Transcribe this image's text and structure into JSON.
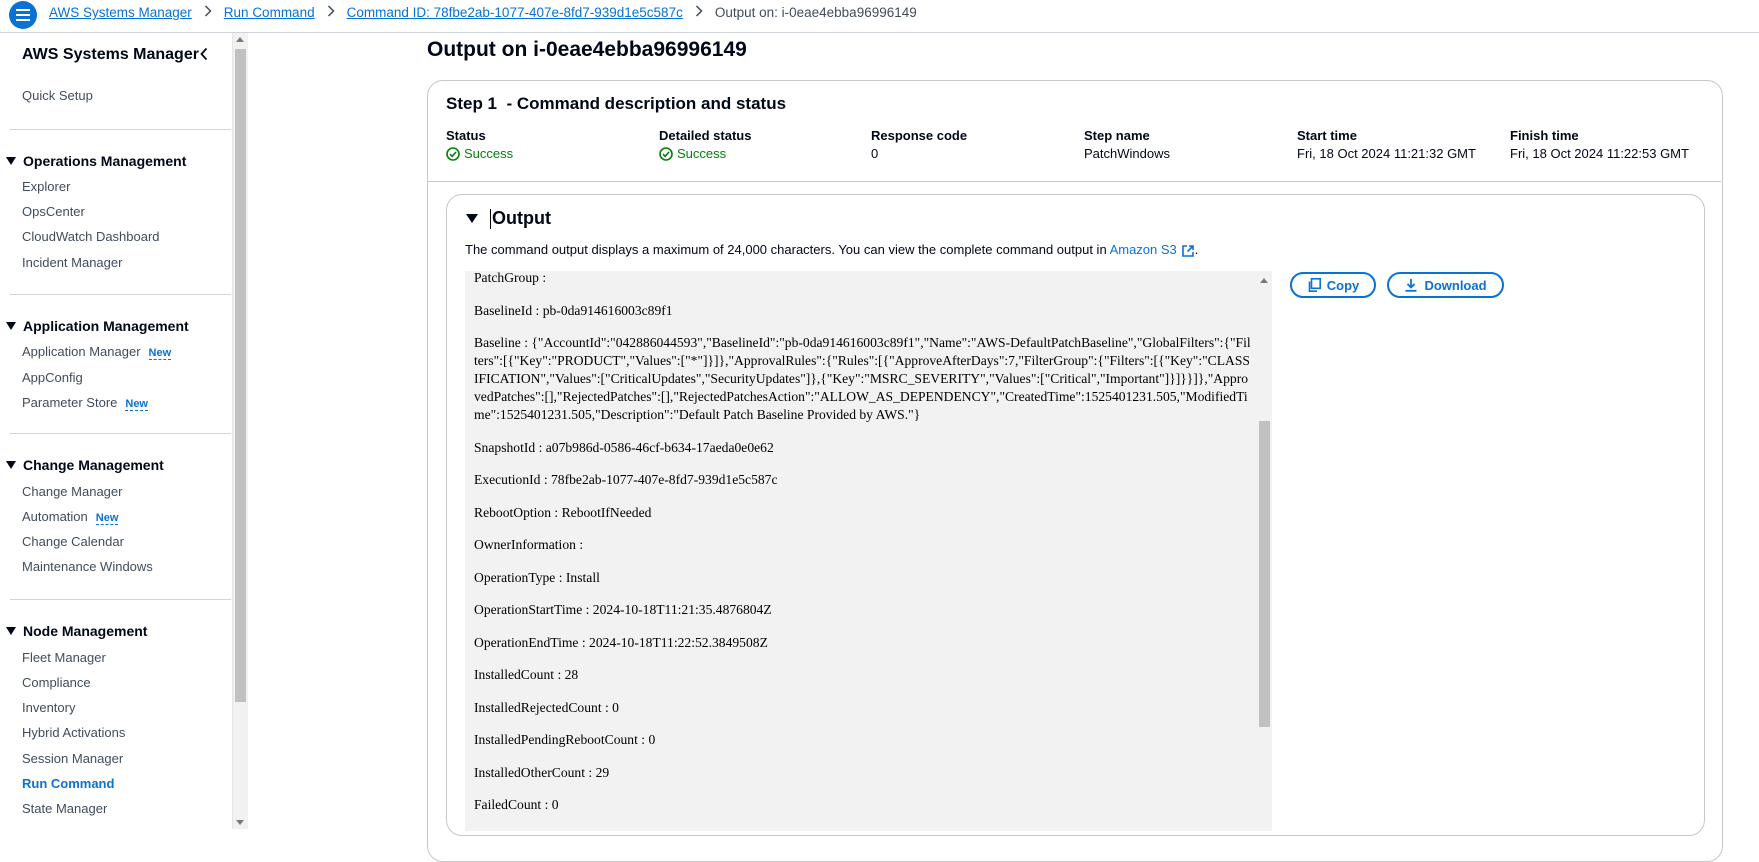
{
  "breadcrumbs": [
    "AWS Systems Manager",
    "Run Command",
    "Command ID: 78fbe2ab-1077-407e-8fd7-939d1e5c587c",
    "Output on: i-0eae4ebba96996149"
  ],
  "sidebar": {
    "title": "AWS Systems Manager",
    "quick_setup": "Quick Setup",
    "sections": [
      {
        "title": "Operations Management",
        "items": [
          "Explorer",
          "OpsCenter",
          "CloudWatch Dashboard",
          "Incident Manager"
        ]
      },
      {
        "title": "Application Management",
        "items": [
          "Application Manager",
          "AppConfig",
          "Parameter Store"
        ]
      },
      {
        "title": "Change Management",
        "items": [
          "Change Manager",
          "Automation",
          "Change Calendar",
          "Maintenance Windows"
        ]
      },
      {
        "title": "Node Management",
        "items": [
          "Fleet Manager",
          "Compliance",
          "Inventory",
          "Hybrid Activations",
          "Session Manager",
          "Run Command",
          "State Manager"
        ]
      }
    ],
    "new_badge": "New",
    "active_item": "Run Command"
  },
  "page_title": "Output on  i-0eae4ebba96996149",
  "step": {
    "title": "Step 1  - Command description and status",
    "fields": [
      {
        "label": "Status",
        "value": "Success"
      },
      {
        "label": "Detailed status",
        "value": "Success"
      },
      {
        "label": "Response code",
        "value": "0"
      },
      {
        "label": "Step name",
        "value": "PatchWindows"
      },
      {
        "label": "Start time",
        "value": "Fri, 18 Oct 2024 11:21:32 GMT"
      },
      {
        "label": "Finish time",
        "value": "Fri, 18 Oct 2024 11:22:53 GMT"
      }
    ]
  },
  "output": {
    "title": "Output",
    "description": "The command output displays a maximum of 24,000 characters. You can view the complete command output in ",
    "link": "Amazon S3",
    "description_end": ".",
    "copy_label": "Copy",
    "download_label": "Download",
    "lines": [
      "PatchGroup :",
      "BaselineId : pb-0da914616003c89f1",
      "Baseline : {\"AccountId\":\"042886044593\",\"BaselineId\":\"pb-0da914616003c89f1\",\"Name\":\"AWS-DefaultPatchBaseline\",\"GlobalFilters\":{\"Filters\":[{\"Key\":\"PRODUCT\",\"Values\":[\"*\"]}]},\"ApprovalRules\":{\"Rules\":[{\"ApproveAfterDays\":7,\"FilterGroup\":{\"Filters\":[{\"Key\":\"CLASSIFICATION\",\"Values\":[\"CriticalUpdates\",\"SecurityUpdates\"]},{\"Key\":\"MSRC_SEVERITY\",\"Values\":[\"Critical\",\"Important\"]}]}}]},\"ApprovedPatches\":[],\"RejectedPatches\":[],\"RejectedPatchesAction\":\"ALLOW_AS_DEPENDENCY\",\"CreatedTime\":1525401231.505,\"ModifiedTime\":1525401231.505,\"Description\":\"Default Patch Baseline Provided by AWS.\"}",
      "SnapshotId : a07b986d-0586-46cf-b634-17aeda0e0e62",
      "ExecutionId : 78fbe2ab-1077-407e-8fd7-939d1e5c587c",
      "RebootOption : RebootIfNeeded",
      "OwnerInformation :",
      "OperationType : Install",
      "OperationStartTime : 2024-10-18T11:21:35.4876804Z",
      "OperationEndTime : 2024-10-18T11:22:52.3849508Z",
      "InstalledCount : 28",
      "InstalledRejectedCount : 0",
      "InstalledPendingRebootCount : 0",
      "InstalledOtherCount : 29",
      "FailedCount : 0"
    ]
  },
  "colors": {
    "accent": "#0972d3",
    "success": "#037f0c",
    "console_bg": "#f2f2f2"
  }
}
